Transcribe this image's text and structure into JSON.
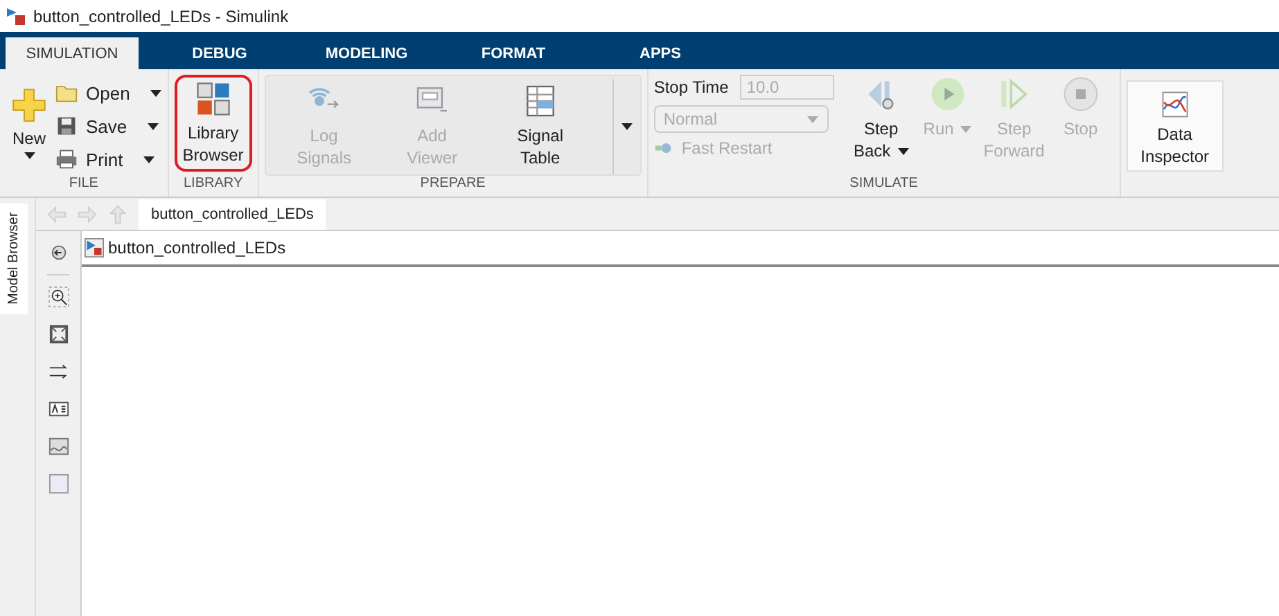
{
  "window": {
    "title": "button_controlled_LEDs - Simulink"
  },
  "tabs": [
    {
      "label": "SIMULATION",
      "selected": true
    },
    {
      "label": "DEBUG",
      "selected": false
    },
    {
      "label": "MODELING",
      "selected": false
    },
    {
      "label": "FORMAT",
      "selected": false
    },
    {
      "label": "APPS",
      "selected": false
    }
  ],
  "file_group": {
    "label": "FILE",
    "new_button": "New",
    "items": [
      {
        "label": "Open"
      },
      {
        "label": "Save"
      },
      {
        "label": "Print"
      }
    ]
  },
  "library_group": {
    "label": "LIBRARY",
    "button": {
      "label": "Library Browser",
      "highlighted": true
    }
  },
  "prepare_group": {
    "label": "PREPARE",
    "buttons": [
      {
        "label": "Log Signals",
        "disabled": true
      },
      {
        "label": "Add Viewer",
        "disabled": true
      },
      {
        "label": "Signal Table",
        "disabled": false
      }
    ]
  },
  "simulate_group": {
    "label": "SIMULATE",
    "stop_time": {
      "label": "Stop Time",
      "value": "10.0",
      "disabled": true
    },
    "mode": {
      "value": "Normal",
      "disabled": true
    },
    "fast_restart": {
      "label": "Fast Restart",
      "disabled": true
    },
    "buttons": [
      {
        "label": "Step Back",
        "disabled": false,
        "dropdown": true
      },
      {
        "label": "Run",
        "disabled": true,
        "dropdown": true
      },
      {
        "label": "Step Forward",
        "disabled": true,
        "dropdown": false
      },
      {
        "label": "Stop",
        "disabled": true,
        "dropdown": false
      }
    ]
  },
  "review_group": {
    "buttons": [
      {
        "label": "Data Inspector"
      }
    ]
  },
  "editor": {
    "side_tab": "Model Browser",
    "model_tab": "button_controlled_LEDs",
    "breadcrumb": "button_controlled_LEDs"
  }
}
